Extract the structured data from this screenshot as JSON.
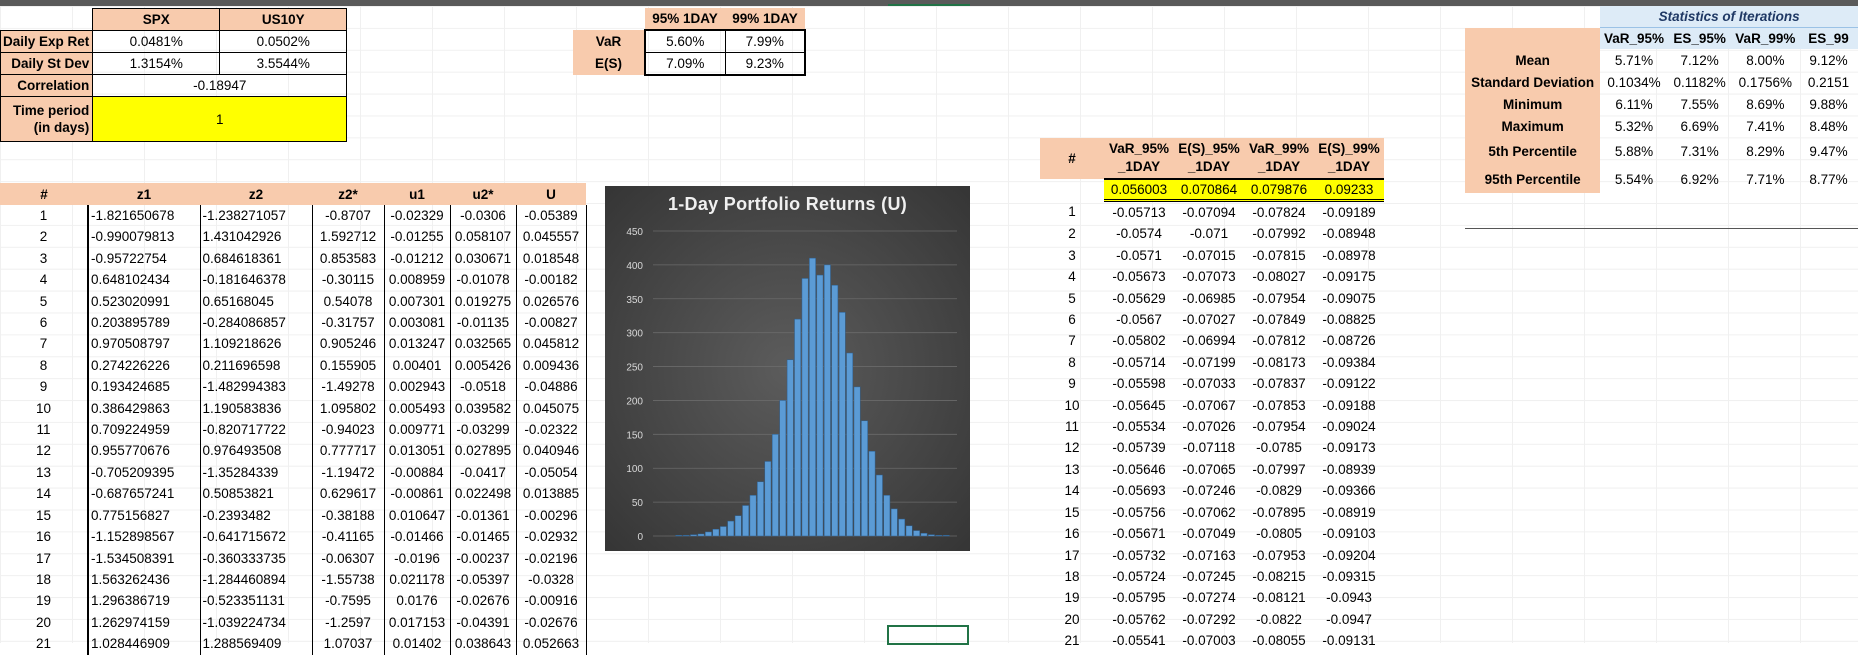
{
  "inputs": {
    "col_headers": [
      "SPX",
      "US10Y"
    ],
    "rows": [
      {
        "label": "Daily Exp Ret",
        "values": [
          "0.0481%",
          "0.0502%"
        ]
      },
      {
        "label": "Daily St Dev",
        "values": [
          "1.3154%",
          "3.5544%"
        ]
      }
    ],
    "correlation_label": "Correlation",
    "correlation_value": "-0.18947",
    "time_label_1": "Time period",
    "time_label_2": "(in days)",
    "time_value": "1"
  },
  "var_table": {
    "headers": [
      "95% 1DAY",
      "99% 1DAY"
    ],
    "rows": [
      {
        "label": "VaR",
        "values": [
          "5.60%",
          "7.99%"
        ]
      },
      {
        "label": "E(S)",
        "values": [
          "7.09%",
          "9.23%"
        ]
      }
    ]
  },
  "sim_table": {
    "headers": [
      "#",
      "z1",
      "z2",
      "z2*",
      "u1",
      "u2*",
      "U"
    ],
    "rows": [
      [
        "1",
        "-1.821650678",
        "-1.238271057",
        "-0.8707",
        "-0.02329",
        "-0.0306",
        "-0.05389"
      ],
      [
        "2",
        "-0.990079813",
        "1.431042926",
        "1.592712",
        "-0.01255",
        "0.058107",
        "0.045557"
      ],
      [
        "3",
        "-0.95722754",
        "0.684618361",
        "0.853583",
        "-0.01212",
        "0.030671",
        "0.018548"
      ],
      [
        "4",
        "0.648102434",
        "-0.181646378",
        "-0.30115",
        "0.008959",
        "-0.01078",
        "-0.00182"
      ],
      [
        "5",
        "0.523020991",
        "0.65168045",
        "0.54078",
        "0.007301",
        "0.019275",
        "0.026576"
      ],
      [
        "6",
        "0.203895789",
        "-0.284086857",
        "-0.31757",
        "0.003081",
        "-0.01135",
        "-0.00827"
      ],
      [
        "7",
        "0.970508797",
        "1.109218626",
        "0.905246",
        "0.013247",
        "0.032565",
        "0.045812"
      ],
      [
        "8",
        "0.274226226",
        "0.211696598",
        "0.155905",
        "0.00401",
        "0.005426",
        "0.009436"
      ],
      [
        "9",
        "0.193424685",
        "-1.482994383",
        "-1.49278",
        "0.002943",
        "-0.0518",
        "-0.04886"
      ],
      [
        "10",
        "0.386429863",
        "1.190583836",
        "1.095802",
        "0.005493",
        "0.039582",
        "0.045075"
      ],
      [
        "11",
        "0.709224959",
        "-0.820717722",
        "-0.94023",
        "0.009771",
        "-0.03299",
        "-0.02322"
      ],
      [
        "12",
        "0.955770676",
        "0.976493508",
        "0.777717",
        "0.013051",
        "0.027895",
        "0.040946"
      ],
      [
        "13",
        "-0.705209395",
        "-1.35284339",
        "-1.19472",
        "-0.00884",
        "-0.0417",
        "-0.05054"
      ],
      [
        "14",
        "-0.687657241",
        "0.50853821",
        "0.629617",
        "-0.00861",
        "0.022498",
        "0.013885"
      ],
      [
        "15",
        "0.775156827",
        "-0.2393482",
        "-0.38188",
        "0.010647",
        "-0.01361",
        "-0.00296"
      ],
      [
        "16",
        "-1.152898567",
        "-0.641715672",
        "-0.41165",
        "-0.01466",
        "-0.01465",
        "-0.02932"
      ],
      [
        "17",
        "-1.534508391",
        "-0.360333735",
        "-0.06307",
        "-0.0196",
        "-0.00237",
        "-0.02196"
      ],
      [
        "18",
        "1.563262436",
        "-1.284460894",
        "-1.55738",
        "0.021178",
        "-0.05397",
        "-0.0328"
      ],
      [
        "19",
        "1.296386719",
        "-0.523351131",
        "-0.7595",
        "0.0176",
        "-0.02676",
        "-0.00916"
      ],
      [
        "20",
        "1.262974159",
        "-1.039224734",
        "-1.2597",
        "0.017153",
        "-0.04391",
        "-0.02676"
      ],
      [
        "21",
        "1.028446909",
        "1.288569409",
        "1.07037",
        "0.01402",
        "0.038643",
        "0.052663"
      ]
    ]
  },
  "chart": {
    "title": "1-Day Portfolio Returns (U)",
    "yticks": [
      "0",
      "50",
      "100",
      "150",
      "200",
      "250",
      "300",
      "350",
      "400",
      "450"
    ],
    "bar_color": "#5b9bd5"
  },
  "chart_data": {
    "type": "bar",
    "title": "1-Day Portfolio Returns (U)",
    "ylim": [
      0,
      450
    ],
    "grid": true,
    "values": [
      1,
      1,
      2,
      3,
      6,
      10,
      14,
      22,
      30,
      45,
      60,
      80,
      110,
      150,
      200,
      260,
      320,
      380,
      410,
      385,
      400,
      370,
      330,
      270,
      220,
      170,
      125,
      90,
      60,
      40,
      25,
      15,
      8,
      4,
      2,
      1,
      1
    ]
  },
  "iter_table": {
    "headers": [
      "#",
      "VaR_95%\n_1DAY",
      "E(S)_95%\n_1DAY",
      "VaR_99%\n_1DAY",
      "E(S)_99%\n_1DAY"
    ],
    "summary": [
      "0.056003",
      "0.070864",
      "0.079876",
      "0.09233"
    ],
    "rows": [
      [
        "1",
        "-0.05713",
        "-0.07094",
        "-0.07824",
        "-0.09189"
      ],
      [
        "2",
        "-0.0574",
        "-0.071",
        "-0.07992",
        "-0.08948"
      ],
      [
        "3",
        "-0.0571",
        "-0.07015",
        "-0.07815",
        "-0.08978"
      ],
      [
        "4",
        "-0.05673",
        "-0.07073",
        "-0.08027",
        "-0.09175"
      ],
      [
        "5",
        "-0.05629",
        "-0.06985",
        "-0.07954",
        "-0.09075"
      ],
      [
        "6",
        "-0.0567",
        "-0.07027",
        "-0.07849",
        "-0.08825"
      ],
      [
        "7",
        "-0.05802",
        "-0.06994",
        "-0.07812",
        "-0.08726"
      ],
      [
        "8",
        "-0.05714",
        "-0.07199",
        "-0.08173",
        "-0.09384"
      ],
      [
        "9",
        "-0.05598",
        "-0.07033",
        "-0.07837",
        "-0.09122"
      ],
      [
        "10",
        "-0.05645",
        "-0.07067",
        "-0.07853",
        "-0.09188"
      ],
      [
        "11",
        "-0.05534",
        "-0.07026",
        "-0.07954",
        "-0.09024"
      ],
      [
        "12",
        "-0.05739",
        "-0.07118",
        "-0.0785",
        "-0.09173"
      ],
      [
        "13",
        "-0.05646",
        "-0.07065",
        "-0.07997",
        "-0.08939"
      ],
      [
        "14",
        "-0.05693",
        "-0.07246",
        "-0.0829",
        "-0.09366"
      ],
      [
        "15",
        "-0.05756",
        "-0.07062",
        "-0.07895",
        "-0.08919"
      ],
      [
        "16",
        "-0.05671",
        "-0.07049",
        "-0.0805",
        "-0.09103"
      ],
      [
        "17",
        "-0.05732",
        "-0.07163",
        "-0.07953",
        "-0.09204"
      ],
      [
        "18",
        "-0.05724",
        "-0.07245",
        "-0.08215",
        "-0.09315"
      ],
      [
        "19",
        "-0.05795",
        "-0.07274",
        "-0.08121",
        "-0.0943"
      ],
      [
        "20",
        "-0.05762",
        "-0.07292",
        "-0.0822",
        "-0.0947"
      ],
      [
        "21",
        "-0.05541",
        "-0.07003",
        "-0.08055",
        "-0.09131"
      ]
    ]
  },
  "stats_table": {
    "title": "Statistics of Iterations",
    "headers": [
      "VaR_95%",
      "ES_95%",
      "VaR_99%",
      "ES_99"
    ],
    "rows": [
      {
        "label": "Mean",
        "values": [
          "5.71%",
          "7.12%",
          "8.00%",
          "9.12%"
        ]
      },
      {
        "label": "Standard Deviation",
        "values": [
          "0.1034%",
          "0.1182%",
          "0.1756%",
          "0.2151"
        ]
      },
      {
        "label": "Minimum",
        "values": [
          "6.11%",
          "7.55%",
          "8.69%",
          "9.88%"
        ]
      },
      {
        "label": "Maximum",
        "values": [
          "5.32%",
          "6.69%",
          "7.41%",
          "8.48%"
        ]
      },
      {
        "label": "5th Percentile",
        "values": [
          "5.88%",
          "7.31%",
          "8.29%",
          "9.47%"
        ]
      },
      {
        "label": "95th Percentile",
        "values": [
          "5.54%",
          "6.92%",
          "7.71%",
          "8.77%"
        ]
      }
    ]
  }
}
